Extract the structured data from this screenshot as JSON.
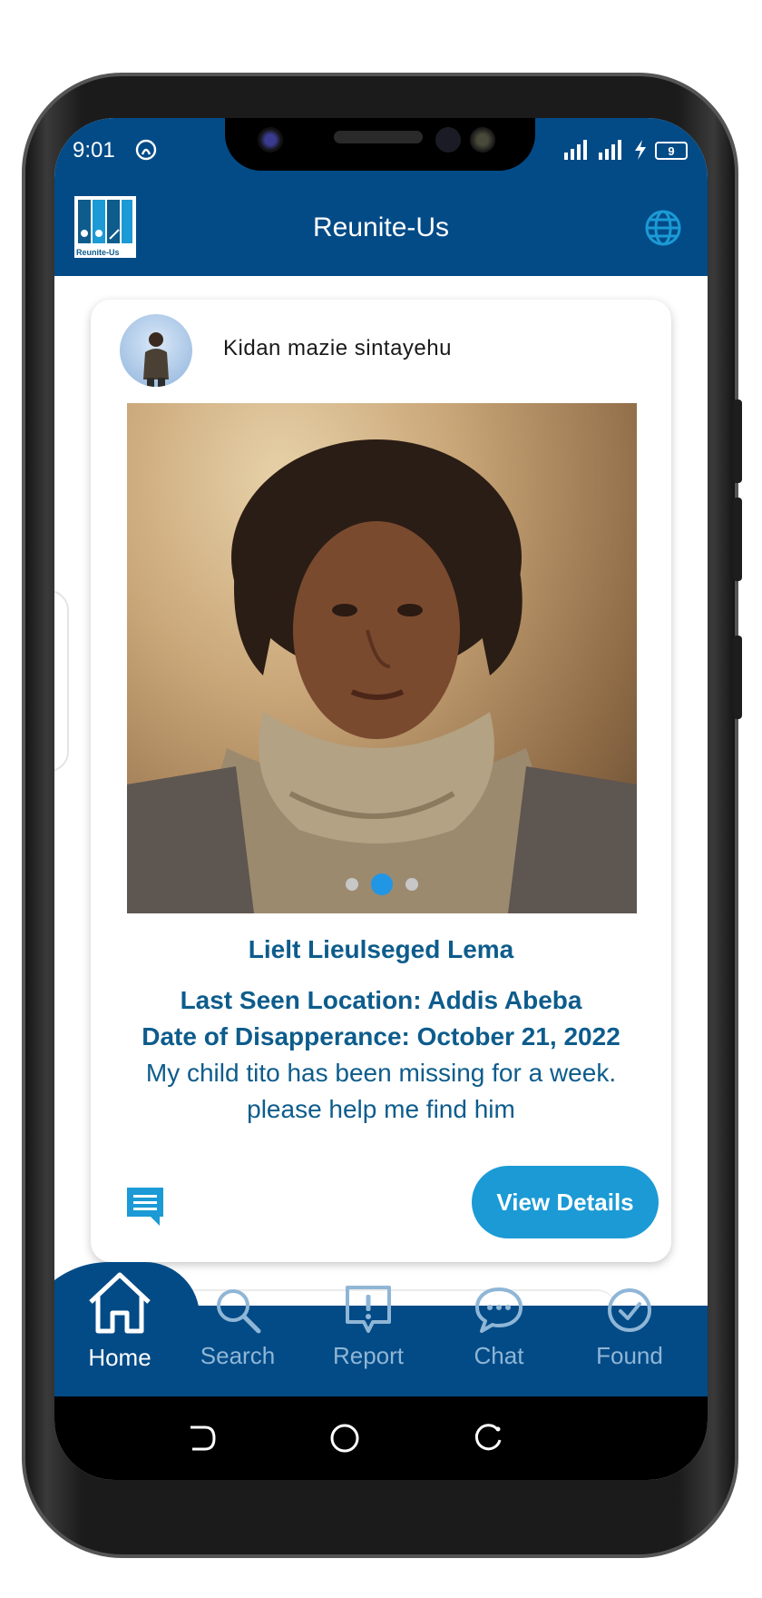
{
  "status_bar": {
    "time": "9:01",
    "battery": "9"
  },
  "app_bar": {
    "title": "Reunite-Us",
    "logo_caption": "Reunite-Us"
  },
  "post": {
    "poster_name": "Kidan mazie sintayehu",
    "missing_person_name": "Lielt Lieulseged Lema",
    "last_seen": "Last Seen Location: Addis Abeba",
    "date_of_disappearance": "Date of Disapperance: October 21, 2022",
    "description": "My child tito has been missing for a week. please help me find him",
    "view_details_label": "View Details",
    "carousel": {
      "count": 3,
      "active_index": 1
    }
  },
  "bottom_nav": {
    "items": [
      {
        "label": "Home",
        "icon": "home-icon",
        "active": true
      },
      {
        "label": "Search",
        "icon": "search-icon",
        "active": false
      },
      {
        "label": "Report",
        "icon": "report-icon",
        "active": false
      },
      {
        "label": "Chat",
        "icon": "chat-icon",
        "active": false
      },
      {
        "label": "Found",
        "icon": "found-icon",
        "active": false
      }
    ]
  },
  "colors": {
    "primary": "#034b87",
    "accent": "#1b9ad5",
    "text_blue": "#0d5c8c",
    "nav_inactive": "#8fb6d6"
  }
}
